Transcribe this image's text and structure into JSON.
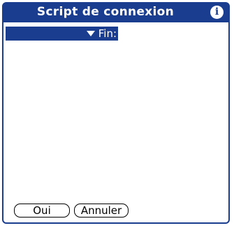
{
  "window": {
    "title": "Script de connexion",
    "info_icon": "info-icon"
  },
  "script": {
    "selected_command": "Fin:",
    "dropdown_icon": "triangle-down-icon"
  },
  "buttons": {
    "ok_label": "Oui",
    "cancel_label": "Annuler"
  },
  "colors": {
    "accent": "#1a3d8f",
    "background": "#ffffff"
  }
}
